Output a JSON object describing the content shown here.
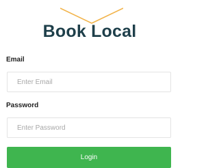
{
  "brand": {
    "name": "Book Local",
    "logo_icon": "open-book-chevron-icon",
    "logo_color": "#f2b44b",
    "name_color": "#1e3f4a"
  },
  "form": {
    "email": {
      "label": "Email",
      "placeholder": "Enter Email",
      "value": ""
    },
    "password": {
      "label": "Password",
      "placeholder": "Enter Password",
      "value": ""
    },
    "submit": {
      "label": "Login",
      "color": "#3fb54f"
    }
  }
}
